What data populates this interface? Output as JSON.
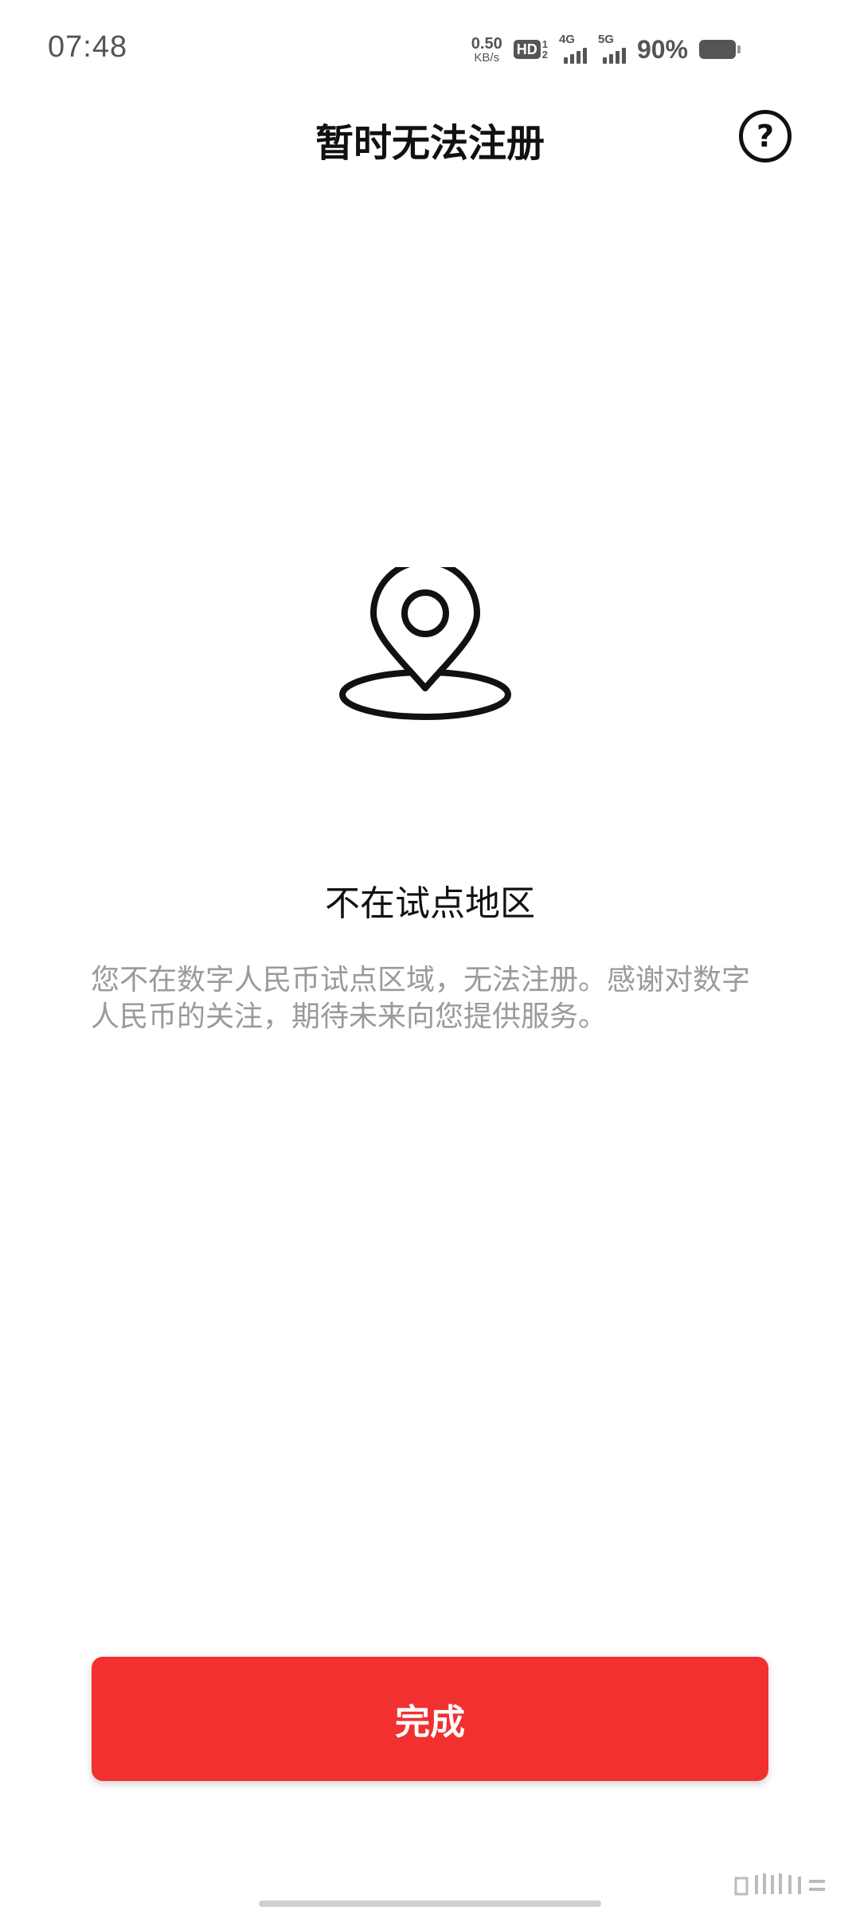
{
  "status_bar": {
    "time": "07:48",
    "net_speed_value": "0.50",
    "net_speed_unit": "KB/s",
    "hd_label": "HD",
    "hd_sub_top": "1",
    "hd_sub_bottom": "2",
    "signal_1_label": "4G",
    "signal_2_label": "5G",
    "battery_percent": "90%"
  },
  "header": {
    "title": "暂时无法注册",
    "help_symbol": "?"
  },
  "main": {
    "icon": "location-pin-icon",
    "heading": "不在试点地区",
    "description": "您不在数字人民币试点区域，无法注册。感谢对数字人民币的关注，期待未来向您提供服务。"
  },
  "footer": {
    "done_label": "完成"
  },
  "colors": {
    "accent": "#f23030",
    "text_primary": "#111111",
    "text_secondary": "#9a9a9a"
  }
}
